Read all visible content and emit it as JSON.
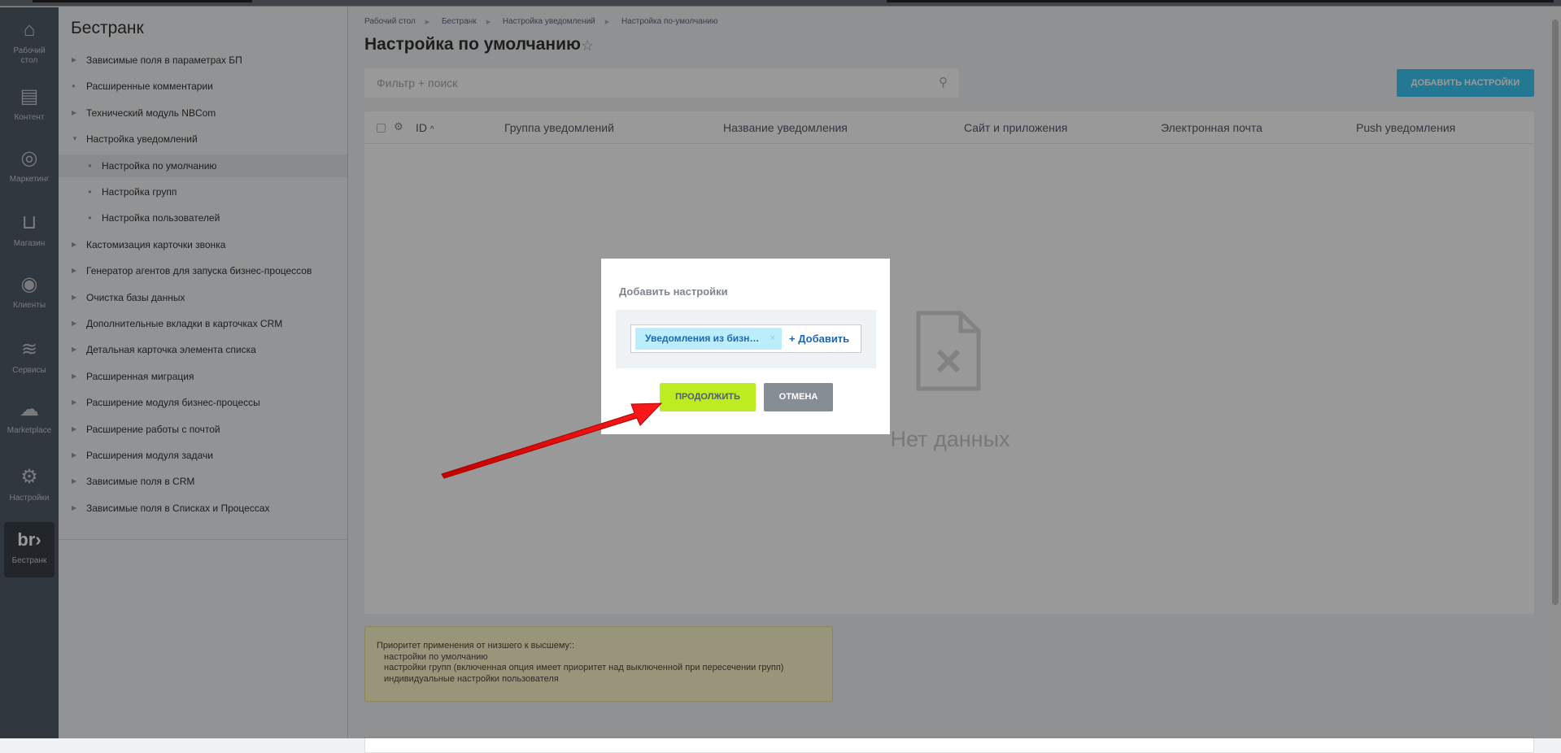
{
  "leftnav": {
    "items": [
      {
        "label": "Рабочий стол",
        "icon": "home-icon"
      },
      {
        "label": "Контент",
        "icon": "document-icon"
      },
      {
        "label": "Маркетинг",
        "icon": "target-icon"
      },
      {
        "label": "Магазин",
        "icon": "basket-icon"
      },
      {
        "label": "Клиенты",
        "icon": "clients-24-icon"
      },
      {
        "label": "Сервисы",
        "icon": "layers-icon"
      },
      {
        "label": "Marketplace",
        "icon": "cloud-download-icon"
      },
      {
        "label": "Настройки",
        "icon": "gear-icon"
      },
      {
        "label": "Бестранк",
        "icon": "brand-logo-icon",
        "logo_text": "br›"
      }
    ]
  },
  "sidebar": {
    "title": "Бестранк",
    "items": [
      {
        "label": "Зависимые поля в параметрах БП",
        "marker": "▶"
      },
      {
        "label": "Расширенные комментарии",
        "marker": "●"
      },
      {
        "label": "Технический модуль NBCom",
        "marker": "▶"
      },
      {
        "label": "Настройка уведомлений",
        "marker": "▼"
      },
      {
        "label": "Настройка по умолчанию",
        "marker": "●",
        "sub": true,
        "active": true
      },
      {
        "label": "Настройка групп",
        "marker": "●",
        "sub": true
      },
      {
        "label": "Настройка пользователей",
        "marker": "●",
        "sub": true
      },
      {
        "label": "Кастомизация карточки звонка",
        "marker": "▶"
      },
      {
        "label": "Генератор агентов для запуска бизнес-процессов",
        "marker": "▶"
      },
      {
        "label": "Очистка базы данных",
        "marker": "▶"
      },
      {
        "label": "Дополнительные вкладки в карточках CRM",
        "marker": "▶"
      },
      {
        "label": "Детальная карточка элемента списка",
        "marker": "▶"
      },
      {
        "label": "Расширенная миграция",
        "marker": "▶"
      },
      {
        "label": "Расширение модуля бизнес-процессы",
        "marker": "▶"
      },
      {
        "label": "Расширение работы с почтой",
        "marker": "▶"
      },
      {
        "label": "Расширения модуля задачи",
        "marker": "▶"
      },
      {
        "label": "Зависимые поля в CRM",
        "marker": "▶"
      },
      {
        "label": "Зависимые поля в Списках и Процессах",
        "marker": "▶"
      }
    ]
  },
  "breadcrumb": [
    "Рабочий стол",
    "Бестранк",
    "Настройка уведомлений",
    "Настройка по-умолчанию"
  ],
  "page": {
    "title": "Настройка по умолчанию",
    "filter_placeholder": "Фильтр + поиск",
    "add_button": "ДОБАВИТЬ НАСТРОЙКИ"
  },
  "table": {
    "columns": [
      "ID",
      "Группа уведомлений",
      "Название уведомления",
      "Сайт и приложения",
      "Электронная почта",
      "Push уведомления"
    ],
    "sort_indicator": "^",
    "empty_text": "Нет данных"
  },
  "notice": {
    "heading": "Приоритет применения от низшего к высшему::",
    "lines": [
      "настройки по умолчанию",
      "настройки групп (включенная опция имеет приоритет над выключенной при пересечении групп)",
      "индивидуальные настройки пользователя"
    ]
  },
  "modal": {
    "title": "Добавить настройки",
    "tag": "Уведомления из бизн…",
    "tag_remove": "×",
    "add_link": "+ Добавить",
    "continue_button": "ПРОДОЛЖИТЬ",
    "cancel_button": "ОТМЕНА"
  },
  "colors": {
    "accent_blue": "#3bc8f5",
    "continue_green": "#bbed21",
    "cancel_gray": "#868d95",
    "arrow_red": "#e00000",
    "tag_bg": "#bcedfc"
  }
}
